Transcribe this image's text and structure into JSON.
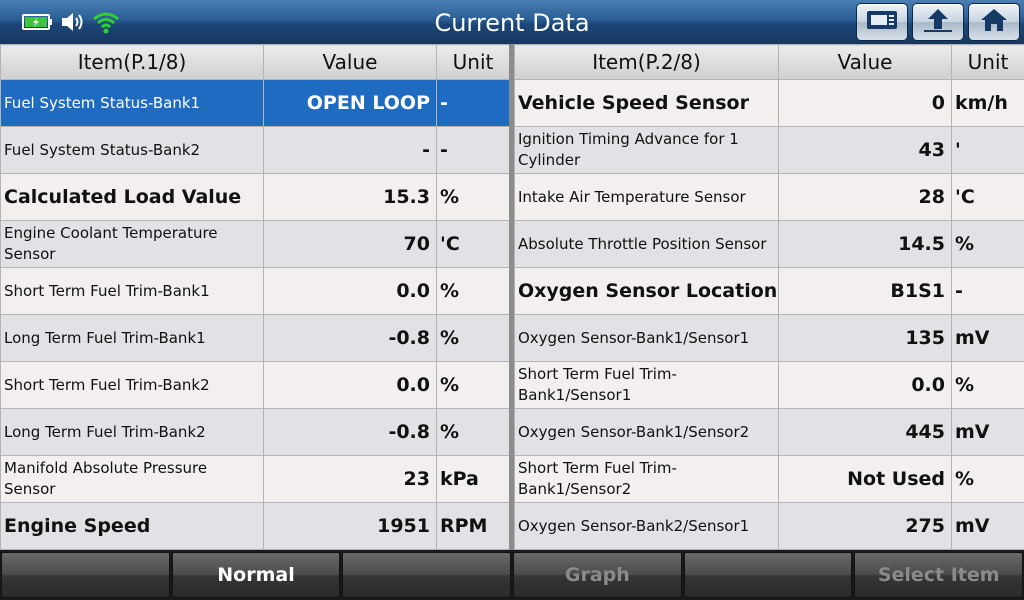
{
  "title": "Current Data",
  "left_table": {
    "headers": {
      "item": "Item(P.1/8)",
      "value": "Value",
      "unit": "Unit"
    },
    "rows": [
      {
        "name": "Fuel System Status-Bank1",
        "value": "OPEN LOOP",
        "unit": "-"
      },
      {
        "name": "Fuel System Status-Bank2",
        "value": "-",
        "unit": "-"
      },
      {
        "name": "Calculated Load Value",
        "value": "15.3",
        "unit": "%"
      },
      {
        "name": "Engine Coolant Temperature Sensor",
        "value": "70",
        "unit": "'C"
      },
      {
        "name": "Short Term Fuel Trim-Bank1",
        "value": "0.0",
        "unit": "%"
      },
      {
        "name": "Long Term Fuel Trim-Bank1",
        "value": "-0.8",
        "unit": "%"
      },
      {
        "name": "Short Term Fuel Trim-Bank2",
        "value": "0.0",
        "unit": "%"
      },
      {
        "name": "Long Term Fuel Trim-Bank2",
        "value": "-0.8",
        "unit": "%"
      },
      {
        "name": "Manifold Absolute Pressure Sensor",
        "value": "23",
        "unit": "kPa"
      },
      {
        "name": "Engine Speed",
        "value": "1951",
        "unit": "RPM"
      }
    ]
  },
  "right_table": {
    "headers": {
      "item": "Item(P.2/8)",
      "value": "Value",
      "unit": "Unit"
    },
    "rows": [
      {
        "name": "Vehicle Speed Sensor",
        "value": "0",
        "unit": "km/h"
      },
      {
        "name": "Ignition Timing Advance for 1 Cylinder",
        "value": "43",
        "unit": "'"
      },
      {
        "name": "Intake Air Temperature Sensor",
        "value": "28",
        "unit": "'C"
      },
      {
        "name": "Absolute Throttle Position Sensor",
        "value": "14.5",
        "unit": "%"
      },
      {
        "name": "Oxygen Sensor Location",
        "value": "B1S1",
        "unit": "-"
      },
      {
        "name": "Oxygen Sensor-Bank1/Sensor1",
        "value": "135",
        "unit": "mV"
      },
      {
        "name": "Short Term Fuel Trim-Bank1/Sensor1",
        "value": "0.0",
        "unit": "%"
      },
      {
        "name": "Oxygen Sensor-Bank1/Sensor2",
        "value": "445",
        "unit": "mV"
      },
      {
        "name": "Short Term Fuel Trim-Bank1/Sensor2",
        "value": "Not Used",
        "unit": "%"
      },
      {
        "name": "Oxygen Sensor-Bank2/Sensor1",
        "value": "275",
        "unit": "mV"
      }
    ]
  },
  "bottom_bar": {
    "buttons": [
      {
        "label": ""
      },
      {
        "label": "Normal"
      },
      {
        "label": ""
      },
      {
        "label": "Graph"
      },
      {
        "label": ""
      },
      {
        "label": "Select Item"
      }
    ]
  },
  "icons": {
    "battery": "battery-icon",
    "speaker": "speaker-icon",
    "wifi": "wifi-icon",
    "print": "print-icon",
    "back": "back-arrow-icon",
    "home": "home-icon"
  },
  "colors": {
    "selected_row": "#1f6bc2",
    "titlebar": "#1c4677",
    "battery": "#3ec43e",
    "wifi": "#2fd12f"
  }
}
